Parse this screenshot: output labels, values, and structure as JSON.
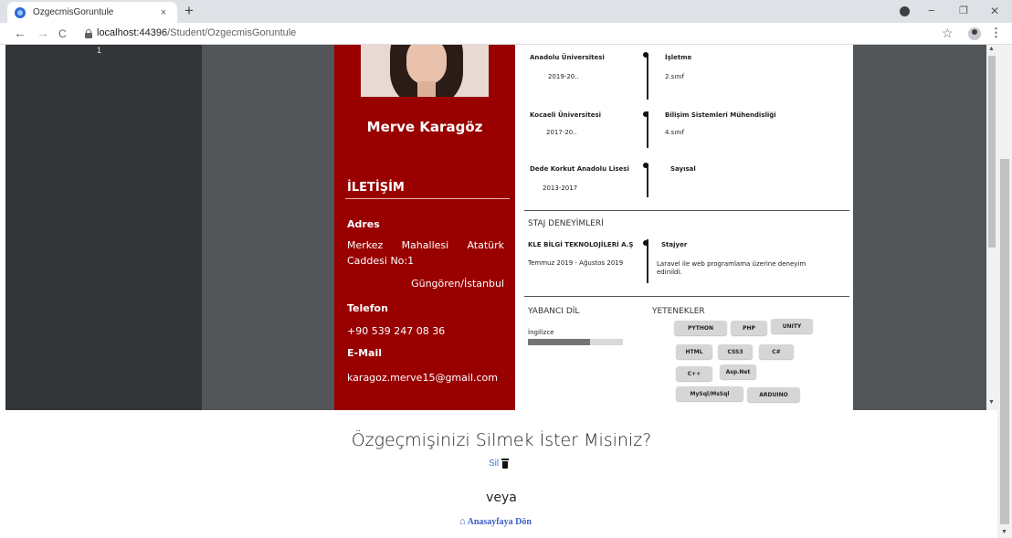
{
  "browser": {
    "tab_title": "OzgecmisGoruntule",
    "tab_close": "×",
    "new_tab": "+",
    "url_host": "localhost:44396",
    "url_path": "/Student/OzgecmisGoruntule",
    "back": "←",
    "forward": "→",
    "reload": "C",
    "bookmark": "☆",
    "menu": "⋮",
    "minimize": "−",
    "maximize": "❐",
    "close": "✕"
  },
  "viewer": {
    "page_number": "1"
  },
  "cv": {
    "name": "Merve Karagöz",
    "contact_heading": "İLETİŞİM",
    "address_label": "Adres",
    "address_words": [
      "Merkez",
      "Mahallesi",
      "Atatürk"
    ],
    "address_line2": "Caddesi No:1",
    "address_line3": "Güngören/İstanbul",
    "phone_label": "Telefon",
    "phone": "+90 539 247 08 36",
    "email_label": "E-Mail",
    "email": "karagoz.merve15@gmail.com",
    "education": [
      {
        "school": "Anadolu Üniversitesi",
        "years": "2019-20..",
        "field": "İşletme",
        "detail": "2.sınıf"
      },
      {
        "school": "Kocaeli Üniversitesi",
        "years": "2017-20..",
        "field": "Bilişim Sistemleri Mühendisliği",
        "detail": "4.sınıf"
      },
      {
        "school": "Dede Korkut Anadolu Lisesi",
        "years": "2013-2017",
        "field": "Sayısal",
        "detail": ""
      }
    ],
    "internship_heading": "STAJ DENEYİMLERİ",
    "internship": {
      "company": "KLE BİLGİ TEKNOLOJİLERİ A.Ş",
      "dates": "Temmuz 2019 - Ağustos 2019",
      "role": "Stajyer",
      "description": "Laravel ile web programlama üzerine deneyim edinildi."
    },
    "language_heading": "YABANCI DİL",
    "language": {
      "name": "İngilizce",
      "level": 0.65
    },
    "skills_heading": "YETENEKLER",
    "skills": [
      "PYTHON",
      "PHP",
      "UNITY",
      "HTML",
      "CSS3",
      "C#",
      "C++",
      "Asp.Net",
      "MySql/MsSql",
      "ARDUINO"
    ]
  },
  "page": {
    "question": "Özgeçmişinizi Silmek İster Misiniz?",
    "delete_label": "Sil",
    "or_label": "veya",
    "home_label": "Anasayfaya Dön"
  }
}
